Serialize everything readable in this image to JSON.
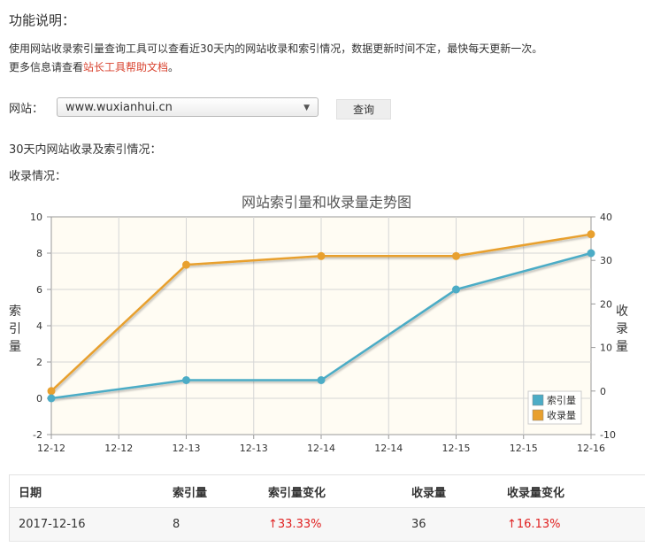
{
  "page": {
    "title": "功能说明：",
    "desc_line1": "使用网站收录索引量查询工具可以查看近30天内的网站收录和索引情况，数据更新时间不定，最快每天更新一次。",
    "desc_line2_prefix": "更多信息请查看",
    "desc_link": "站长工具帮助文档",
    "desc_line2_suffix": "。",
    "site_label": "网站：",
    "site_value": "www.wuxianhui.cn",
    "query_button": "查询",
    "section_30days": "30天内网站收录及索引情况：",
    "section_included": "收录情况："
  },
  "colors": {
    "index": "#4cacc6",
    "included": "#e8a02e",
    "up": "#e02020",
    "link": "#d9432f"
  },
  "chart_data": {
    "type": "line",
    "title": "网站索引量和收录量走势图",
    "x_tick_labels": [
      "12-12",
      "12-12",
      "12-13",
      "12-13",
      "12-14",
      "12-14",
      "12-15",
      "12-15",
      "12-16"
    ],
    "x": [
      "12-12",
      "12-13",
      "12-14",
      "12-15",
      "12-16"
    ],
    "series": [
      {
        "name": "索引量",
        "axis": "left",
        "color": "#4cacc6",
        "values": [
          0,
          1,
          1,
          6,
          8
        ]
      },
      {
        "name": "收录量",
        "axis": "right",
        "color": "#e8a02e",
        "values": [
          0,
          29,
          31,
          31,
          36
        ]
      }
    ],
    "ylabel": "索引量",
    "y2label": "收录量",
    "ylim": [
      -2,
      10
    ],
    "y2lim": [
      -10,
      40
    ],
    "y_ticks": [
      -2,
      0,
      2,
      4,
      6,
      8,
      10
    ],
    "y2_ticks": [
      -10,
      0,
      10,
      20,
      30,
      40
    ],
    "grid": true,
    "legend_position": "bottom-right"
  },
  "table": {
    "headers": [
      "日期",
      "索引量",
      "索引量变化",
      "收录量",
      "收录量变化"
    ],
    "rows": [
      [
        "2017-12-16",
        "8",
        "↑33.33%",
        "36",
        "↑16.13%"
      ]
    ]
  }
}
